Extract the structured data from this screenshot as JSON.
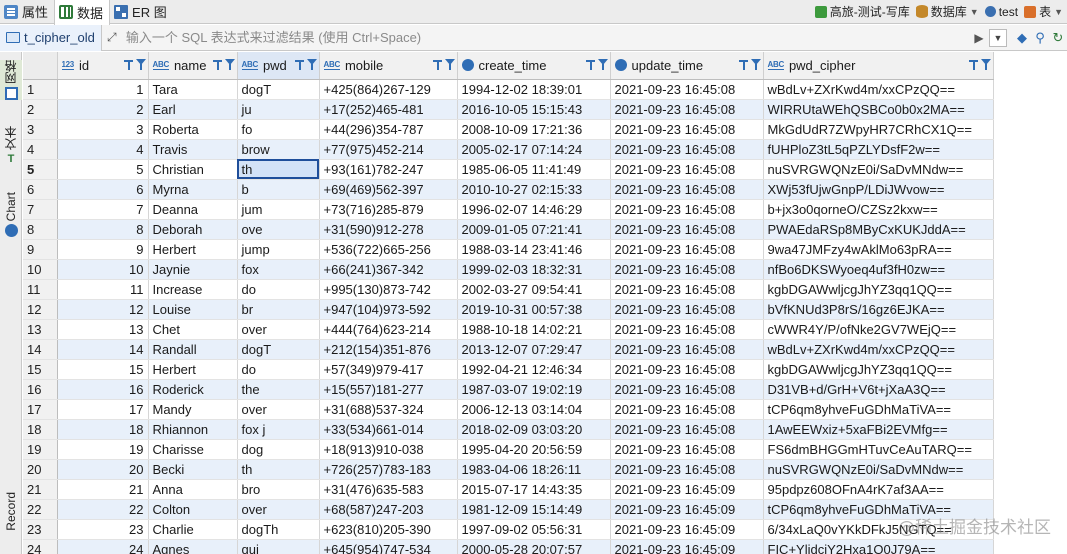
{
  "top_tabs": [
    {
      "label": "属性",
      "icon": "properties-icon",
      "active": false
    },
    {
      "label": "数据",
      "icon": "data-grid-icon",
      "active": true
    },
    {
      "label": "ER 图",
      "icon": "er-diagram-icon",
      "active": false
    }
  ],
  "top_right": {
    "connection": "高旅-测试-写库",
    "database": "数据库",
    "user": "test",
    "table": "表"
  },
  "filter": {
    "table_name": "t_cipher_old",
    "placeholder": "输入一个 SQL 表达式来过滤结果 (使用 Ctrl+Space)"
  },
  "left_tabs": [
    {
      "label": "网格",
      "icon": "grid-icon"
    },
    {
      "label": "文本",
      "icon": "text-icon"
    },
    {
      "label": "Chart",
      "icon": "chart-icon"
    },
    {
      "label": "Record",
      "icon": ""
    }
  ],
  "columns": [
    {
      "name": "id",
      "type": "123"
    },
    {
      "name": "name",
      "type": "ABC"
    },
    {
      "name": "pwd",
      "type": "ABC"
    },
    {
      "name": "mobile",
      "type": "ABC"
    },
    {
      "name": "create_time",
      "type": "time"
    },
    {
      "name": "update_time",
      "type": "time"
    },
    {
      "name": "pwd_cipher",
      "type": "ABC"
    }
  ],
  "rows": [
    [
      "1",
      "Tara",
      "dogT",
      "+425(864)267-129",
      "1994-12-02 18:39:01",
      "2021-09-23 16:45:08",
      "wBdLv+ZXrKwd4m/xxCPzQQ=="
    ],
    [
      "2",
      "Earl",
      "ju",
      "+17(252)465-481",
      "2016-10-05 15:15:43",
      "2021-09-23 16:45:08",
      "WIRRUtaWEhQSBCo0b0x2MA=="
    ],
    [
      "3",
      "Roberta",
      "fo",
      "+44(296)354-787",
      "2008-10-09 17:21:36",
      "2021-09-23 16:45:08",
      "MkGdUdR7ZWpyHR7CRhCX1Q=="
    ],
    [
      "4",
      "Travis",
      "brow",
      "+77(975)452-214",
      "2005-02-17 07:14:24",
      "2021-09-23 16:45:08",
      "fUHPloZ3tL5qPZLYDsfF2w=="
    ],
    [
      "5",
      "Christian",
      "th",
      "+93(161)782-247",
      "1985-06-05 11:41:49",
      "2021-09-23 16:45:08",
      "nuSVRGWQNzE0i/SaDvMNdw=="
    ],
    [
      "6",
      "Myrna",
      "b",
      "+69(469)562-397",
      "2010-10-27 02:15:33",
      "2021-09-23 16:45:08",
      "XWj53fUjwGnpP/LDiJWvow=="
    ],
    [
      "7",
      "Deanna",
      "jum",
      "+73(716)285-879",
      "1996-02-07 14:46:29",
      "2021-09-23 16:45:08",
      "b+jx3o0qorneO/CZSz2kxw=="
    ],
    [
      "8",
      "Deborah",
      "ove",
      "+31(590)912-278",
      "2009-01-05 07:21:41",
      "2021-09-23 16:45:08",
      "PWAEdaRSp8MByCxKUKJddA=="
    ],
    [
      "9",
      "Herbert",
      "jump",
      "+536(722)665-256",
      "1988-03-14 23:41:46",
      "2021-09-23 16:45:08",
      "9wa47JMFzy4wAklMo63pRA=="
    ],
    [
      "10",
      "Jaynie",
      "fox",
      "+66(241)367-342",
      "1999-02-03 18:32:31",
      "2021-09-23 16:45:08",
      "nfBo6DKSWyoeq4uf3fH0zw=="
    ],
    [
      "11",
      "Increase",
      "do",
      "+995(130)873-742",
      "2002-03-27 09:54:41",
      "2021-09-23 16:45:08",
      "kgbDGAWwljcgJhYZ3qq1QQ=="
    ],
    [
      "12",
      "Louise",
      "br",
      "+947(104)973-592",
      "2019-10-31 00:57:38",
      "2021-09-23 16:45:08",
      "bVfKNUd3P8rS/16gz6EJKA=="
    ],
    [
      "13",
      "Chet",
      "over",
      "+444(764)623-214",
      "1988-10-18 14:02:21",
      "2021-09-23 16:45:08",
      "cWWR4Y/P/ofNke2GV7WEjQ=="
    ],
    [
      "14",
      "Randall",
      "dogT",
      "+212(154)351-876",
      "2013-12-07 07:29:47",
      "2021-09-23 16:45:08",
      "wBdLv+ZXrKwd4m/xxCPzQQ=="
    ],
    [
      "15",
      "Herbert",
      "do",
      "+57(349)979-417",
      "1992-04-21 12:46:34",
      "2021-09-23 16:45:08",
      "kgbDGAWwljcgJhYZ3qq1QQ=="
    ],
    [
      "16",
      "Roderick",
      "the",
      "+15(557)181-277",
      "1987-03-07 19:02:19",
      "2021-09-23 16:45:08",
      "D31VB+d/GrH+V6t+jXaA3Q=="
    ],
    [
      "17",
      "Mandy",
      "over",
      "+31(688)537-324",
      "2006-12-13 03:14:04",
      "2021-09-23 16:45:08",
      "tCP6qm8yhveFuGDhMaTiVA=="
    ],
    [
      "18",
      "Rhiannon",
      "fox j",
      "+33(534)661-014",
      "2018-02-09 03:03:20",
      "2021-09-23 16:45:08",
      "1AwEEWxiz+5xaFBi2EVMfg=="
    ],
    [
      "19",
      "Charisse",
      "dog",
      "+18(913)910-038",
      "1995-04-20 20:56:59",
      "2021-09-23 16:45:08",
      "FS6dmBHGGmHTuvCeAuTARQ=="
    ],
    [
      "20",
      "Becki",
      "th",
      "+726(257)783-183",
      "1983-04-06 18:26:11",
      "2021-09-23 16:45:08",
      "nuSVRGWQNzE0i/SaDvMNdw=="
    ],
    [
      "21",
      "Anna",
      "bro",
      "+31(476)635-583",
      "2015-07-17 14:43:35",
      "2021-09-23 16:45:09",
      "95pdpz608OFnA4rK7af3AA=="
    ],
    [
      "22",
      "Colton",
      "over",
      "+68(587)247-203",
      "1981-12-09 15:14:49",
      "2021-09-23 16:45:09",
      "tCP6qm8yhveFuGDhMaTiVA=="
    ],
    [
      "23",
      "Charlie",
      "dogTh",
      "+623(810)205-390",
      "1997-09-02 05:56:31",
      "2021-09-23 16:45:09",
      "6/34xLaQ0vYKkDFkJ5NGTQ=="
    ],
    [
      "24",
      "Agnes",
      "qui",
      "+645(954)747-534",
      "2000-05-28 20:07:57",
      "2021-09-23 16:45:09",
      "FIC+YlidciY2Hxa1O0J79A=="
    ]
  ],
  "selected": {
    "row": 5,
    "column": "pwd"
  },
  "watermark": "@稀土掘金技术社区"
}
